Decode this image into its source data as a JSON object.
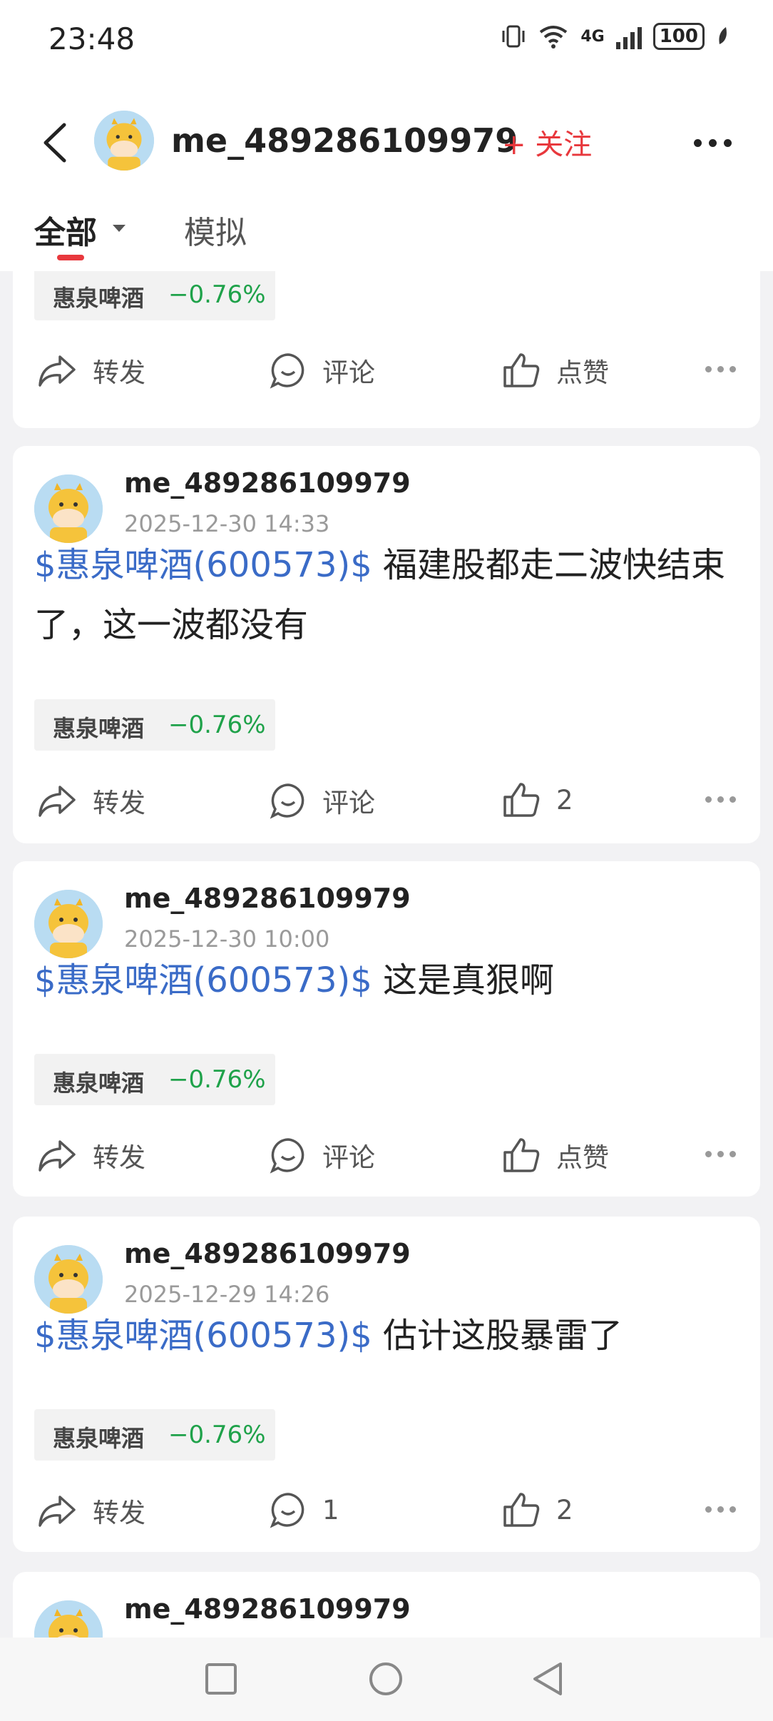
{
  "status_bar": {
    "time": "23:48",
    "network": "4G",
    "sim": "6",
    "battery": "100"
  },
  "header": {
    "username": "me_489286109979",
    "follow_label": "+ 关注"
  },
  "tabs": {
    "all": "全部",
    "sim": "模拟"
  },
  "stock_chip": {
    "name": "惠泉啤酒",
    "change": "−0.76%"
  },
  "posts": [
    {
      "stock_tag": "",
      "text": "",
      "actions": {
        "forward": "转发",
        "comment": "评论",
        "like": "点赞"
      }
    },
    {
      "author": "me_489286109979",
      "time": "2025-12-30 14:33",
      "stock_tag": "$惠泉啤酒(600573)$",
      "text": " 福建股都走二波快结束了，这一波都没有",
      "actions": {
        "forward": "转发",
        "comment": "评论",
        "like": "2"
      }
    },
    {
      "author": "me_489286109979",
      "time": "2025-12-30 10:00",
      "stock_tag": "$惠泉啤酒(600573)$",
      "text": " 这是真狠啊",
      "actions": {
        "forward": "转发",
        "comment": "评论",
        "like": "点赞"
      }
    },
    {
      "author": "me_489286109979",
      "time": "2025-12-29 14:26",
      "stock_tag": "$惠泉啤酒(600573)$",
      "text": " 估计这股暴雷了",
      "actions": {
        "forward": "转发",
        "comment": "1",
        "like": "2"
      }
    },
    {
      "author": "me_489286109979"
    }
  ]
}
